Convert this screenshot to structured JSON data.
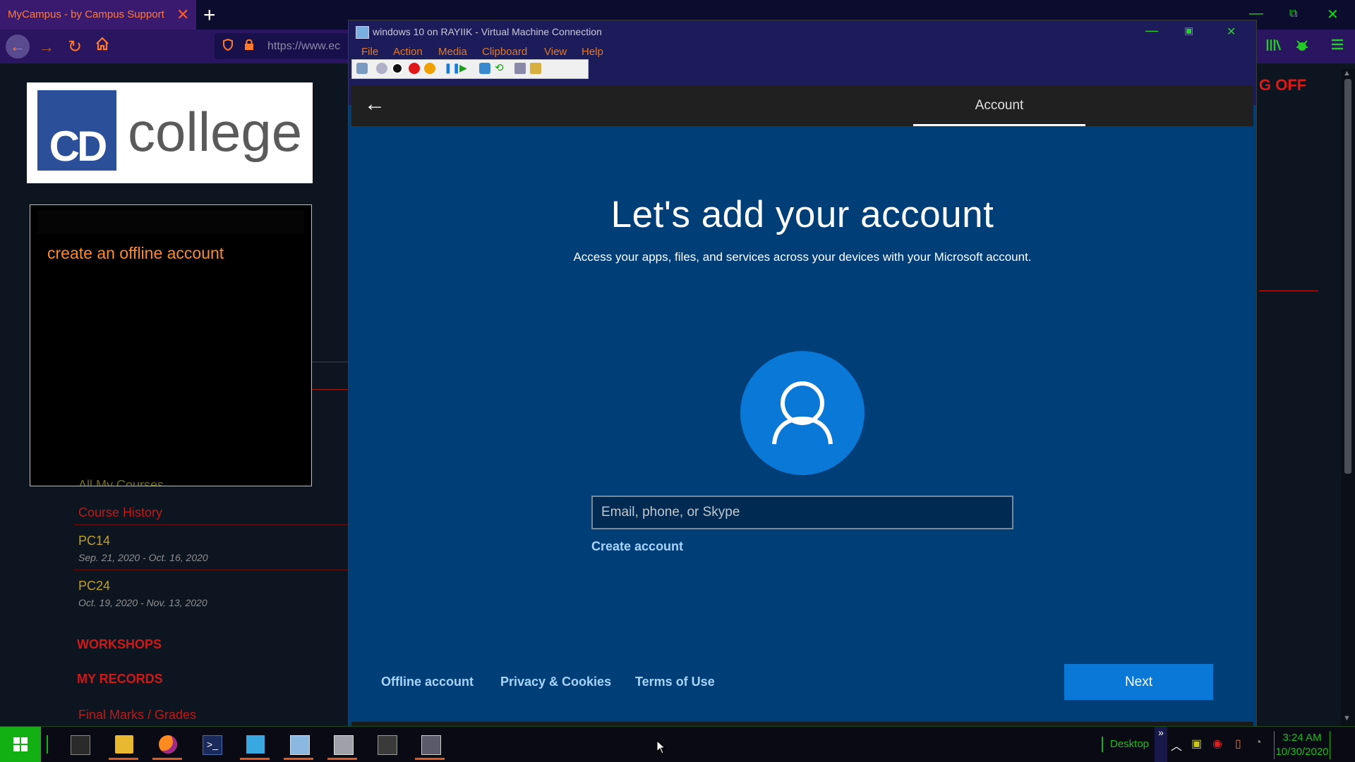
{
  "browser": {
    "tab_title": "MyCampus - by Campus Support",
    "tab_close": "✕",
    "new_tab": "+",
    "url": "https://www.ec",
    "right_fragment": "G OFF"
  },
  "sidebar": {
    "logo_cd": "CD",
    "logo_text": "college",
    "popup_text": "create an offline account",
    "partial_link": "All My Courses",
    "course_history": "Course History",
    "courses": [
      {
        "name": "PC14",
        "dates": "Sep. 21, 2020 - Oct. 16, 2020"
      },
      {
        "name": "PC24",
        "dates": "Oct. 19, 2020 - Nov. 13, 2020"
      }
    ],
    "workshops": "WORKSHOPS",
    "my_records": "MY RECORDS",
    "final_marks": "Final Marks / Grades"
  },
  "vm": {
    "window_title": "windows 10 on RAYIIK - Virtual Machine Connection",
    "menu": [
      "File",
      "Action",
      "Media",
      "Clipboard",
      "View",
      "Help"
    ],
    "header_tab": "Account",
    "title": "Let's add your account",
    "subtitle": "Access your apps, files, and services across your devices with your Microsoft account.",
    "email_placeholder": "Email, phone, or Skype",
    "email_value": "",
    "create_account": "Create account",
    "footer": {
      "offline": "Offline account",
      "privacy": "Privacy & Cookies",
      "terms": "Terms of Use",
      "next": "Next"
    }
  },
  "taskbar": {
    "desktop_label": "Desktop",
    "clock_time": "3:24 AM",
    "clock_date": "10/30/2020"
  },
  "colors": {
    "accent_green": "#18c018",
    "accent_orange": "#ff7a2a",
    "oobe_blue": "#003e78",
    "button_blue": "#0a78d7"
  }
}
